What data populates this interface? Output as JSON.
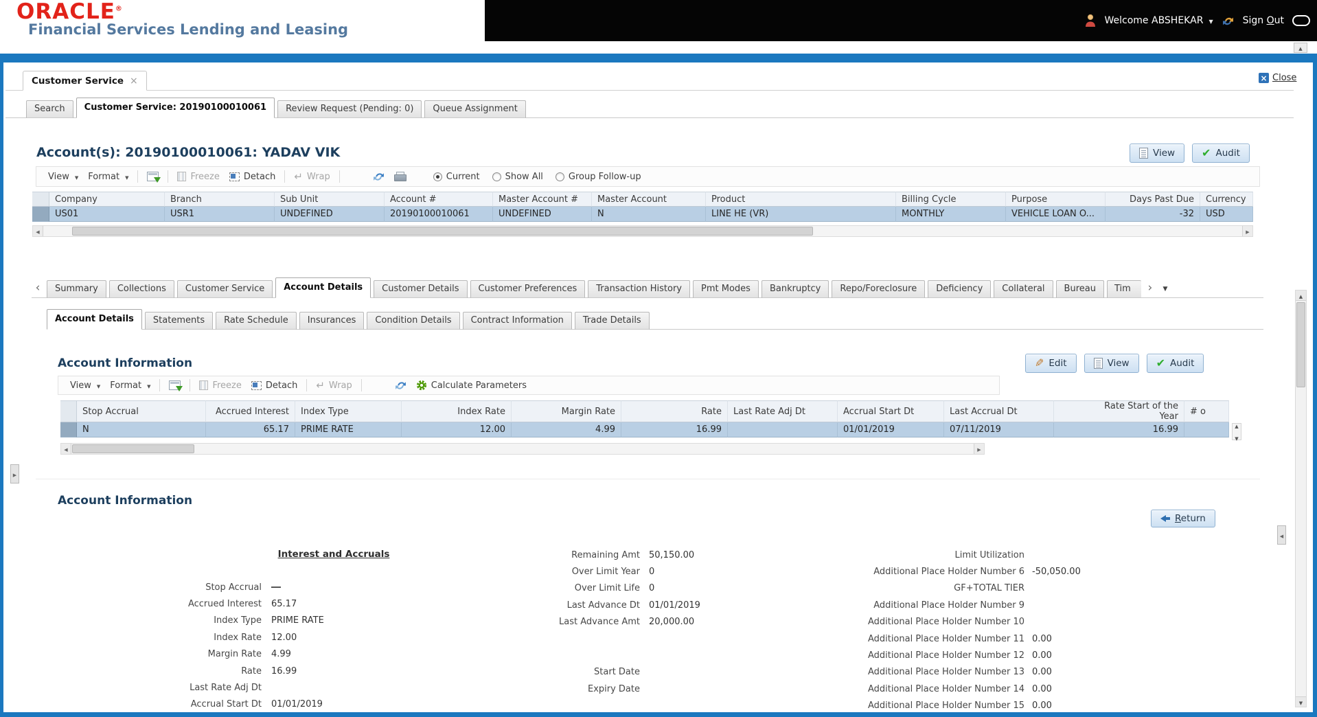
{
  "topbar": {
    "brand": "ORACLE",
    "brand_mark": "®",
    "tagline": "Financial Services Lending and Leasing",
    "welcome": "Welcome ABSHEKAR",
    "sign_out": {
      "prefix": "Sign ",
      "accesskey": "O",
      "suffix": "ut"
    }
  },
  "window": {
    "tab": "Customer Service",
    "close": "Close"
  },
  "nav_tabs": [
    {
      "label": "Search"
    },
    {
      "label": "Customer Service: 20190100010061",
      "active": true
    },
    {
      "label": "Review Request (Pending: 0)"
    },
    {
      "label": "Queue Assignment"
    }
  ],
  "account_section": {
    "heading": "Account(s): 20190100010061: YADAV VIK",
    "buttons": [
      {
        "label": "View",
        "icon": "document-icon"
      },
      {
        "label": "Audit",
        "icon": "check-icon"
      }
    ],
    "toolbar": {
      "view": "View",
      "format": "Format",
      "freeze": "Freeze",
      "detach": "Detach",
      "wrap": "Wrap",
      "radios": [
        {
          "label": "Current",
          "selected": true
        },
        {
          "label": "Show All",
          "selected": false
        },
        {
          "label": "Group Follow-up",
          "selected": false
        }
      ]
    },
    "table": {
      "columns": [
        {
          "label": "Company"
        },
        {
          "label": "Branch"
        },
        {
          "label": "Sub Unit"
        },
        {
          "label": "Account #"
        },
        {
          "label": "Master Account #"
        },
        {
          "label": "Master Account"
        },
        {
          "label": "Product"
        },
        {
          "label": "Billing Cycle"
        },
        {
          "label": "Purpose"
        },
        {
          "label": "Days Past Due",
          "align": "right"
        },
        {
          "label": "Currency"
        }
      ],
      "row": [
        "US01",
        "USR1",
        "UNDEFINED",
        "20190100010061",
        "UNDEFINED",
        "N",
        "LINE HE (VR)",
        "MONTHLY",
        "VEHICLE LOAN O...",
        "-32",
        "USD"
      ]
    }
  },
  "detail_tabs": [
    {
      "label": "Summary"
    },
    {
      "label": "Collections"
    },
    {
      "label": "Customer Service"
    },
    {
      "label": "Account Details",
      "active": true
    },
    {
      "label": "Customer Details"
    },
    {
      "label": "Customer Preferences"
    },
    {
      "label": "Transaction History"
    },
    {
      "label": "Pmt Modes"
    },
    {
      "label": "Bankruptcy"
    },
    {
      "label": "Repo/Foreclosure"
    },
    {
      "label": "Deficiency"
    },
    {
      "label": "Collateral"
    },
    {
      "label": "Bureau"
    },
    {
      "label": "Tim",
      "clipped": true
    }
  ],
  "sub_tabs": [
    {
      "label": "Account Details",
      "active": true
    },
    {
      "label": "Statements"
    },
    {
      "label": "Rate Schedule"
    },
    {
      "label": "Insurances"
    },
    {
      "label": "Condition Details"
    },
    {
      "label": "Contract Information"
    },
    {
      "label": "Trade Details"
    }
  ],
  "account_information": {
    "heading": "Account Information",
    "buttons": [
      {
        "label": "Edit",
        "icon": "pencil-icon"
      },
      {
        "label": "View",
        "icon": "document-icon"
      },
      {
        "label": "Audit",
        "icon": "check-icon"
      }
    ],
    "toolbar": {
      "view": "View",
      "format": "Format",
      "freeze": "Freeze",
      "detach": "Detach",
      "wrap": "Wrap",
      "calculate": "Calculate Parameters"
    },
    "table": {
      "columns": [
        {
          "label": "Stop Accrual"
        },
        {
          "label": "Accrued Interest",
          "align": "right"
        },
        {
          "label": "Index Type"
        },
        {
          "label": "Index Rate",
          "align": "right"
        },
        {
          "label": "Margin Rate",
          "align": "right"
        },
        {
          "label": "Rate",
          "align": "right"
        },
        {
          "label": "Last Rate Adj Dt"
        },
        {
          "label": "Accrual Start Dt"
        },
        {
          "label": "Last Accrual Dt"
        },
        {
          "label": "Rate Start of the Year",
          "align": "right",
          "two_line": true
        },
        {
          "label": "# o",
          "clipped": true
        }
      ],
      "row": [
        "N",
        "65.17",
        "PRIME RATE",
        "12.00",
        "4.99",
        "16.99",
        "",
        "01/01/2019",
        "07/11/2019",
        "16.99",
        ""
      ]
    }
  },
  "detail_view": {
    "heading": "Account Information",
    "return_button": {
      "accesskey": "R",
      "rest": "eturn"
    },
    "group_header": "Interest and Accruals",
    "columns": [
      {
        "fields": [
          {
            "label": "Stop Accrual",
            "value": "",
            "dash": true
          },
          {
            "label": "Accrued Interest",
            "value": "65.17"
          },
          {
            "label": "Index Type",
            "value": "PRIME RATE"
          },
          {
            "label": "Index Rate",
            "value": "12.00"
          },
          {
            "label": "Margin Rate",
            "value": "4.99"
          },
          {
            "label": "Rate",
            "value": "16.99"
          },
          {
            "label": "Last Rate Adj Dt",
            "value": ""
          },
          {
            "label": "Accrual Start Dt",
            "value": "01/01/2019"
          }
        ]
      },
      {
        "fields": [
          {
            "label": "Remaining Amt",
            "value": "50,150.00"
          },
          {
            "label": "Over Limit Year",
            "value": "0"
          },
          {
            "label": "Over Limit Life",
            "value": "0"
          },
          {
            "label": "Last Advance Dt",
            "value": "01/01/2019"
          },
          {
            "label": "Last Advance Amt",
            "value": "20,000.00"
          },
          null,
          null,
          {
            "label": "Start Date",
            "value": ""
          },
          {
            "label": "Expiry Date",
            "value": ""
          }
        ]
      },
      {
        "fields": [
          {
            "label": "Limit Utilization",
            "value": ""
          },
          {
            "label": "Additional Place Holder Number 6",
            "value": "-50,050.00"
          },
          {
            "label": "GF+TOTAL TIER",
            "value": ""
          },
          {
            "label": "Additional Place Holder Number 9",
            "value": ""
          },
          {
            "label": "Additional Place Holder Number 10",
            "value": ""
          },
          {
            "label": "Additional Place Holder Number 11",
            "value": "0.00"
          },
          {
            "label": "Additional Place Holder Number 12",
            "value": "0.00"
          },
          {
            "label": "Additional Place Holder Number 13",
            "value": "0.00"
          },
          {
            "label": "Additional Place Holder Number 14",
            "value": "0.00"
          },
          {
            "label": "Additional Place Holder Number 15",
            "value": "0.00"
          }
        ]
      }
    ]
  }
}
